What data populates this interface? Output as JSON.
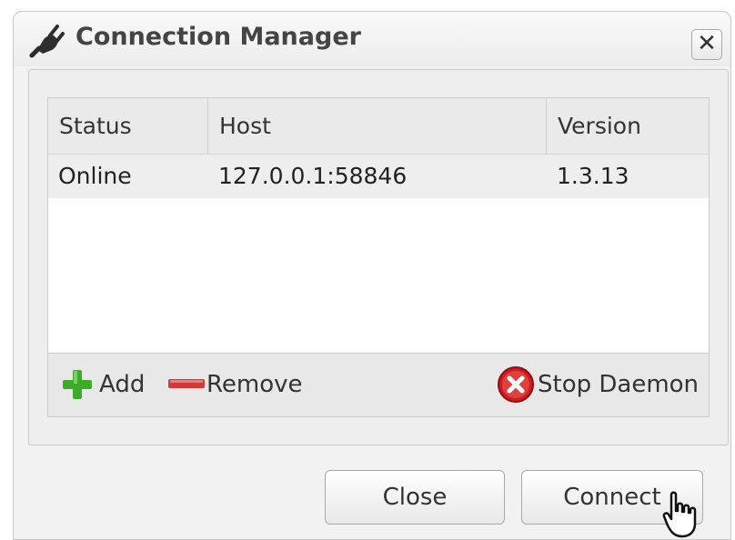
{
  "window": {
    "title": "Connection Manager",
    "title_icon": "plug-icon",
    "close_icon": "close-icon",
    "close_glyph": "✕"
  },
  "table": {
    "columns": [
      "Status",
      "Host",
      "Version"
    ],
    "rows": [
      {
        "status": "Online",
        "host": "127.0.0.1:58846",
        "version": "1.3.13"
      }
    ]
  },
  "toolbar": {
    "add_label": "Add",
    "add_icon": "plus-icon",
    "remove_label": "Remove",
    "remove_icon": "minus-icon",
    "stop_label": "Stop Daemon",
    "stop_icon": "stop-icon"
  },
  "buttons": {
    "close_label": "Close",
    "connect_label": "Connect"
  },
  "colors": {
    "add_green": "#3daa2a",
    "remove_red": "#d23a3a",
    "stop_red": "#c82020"
  }
}
